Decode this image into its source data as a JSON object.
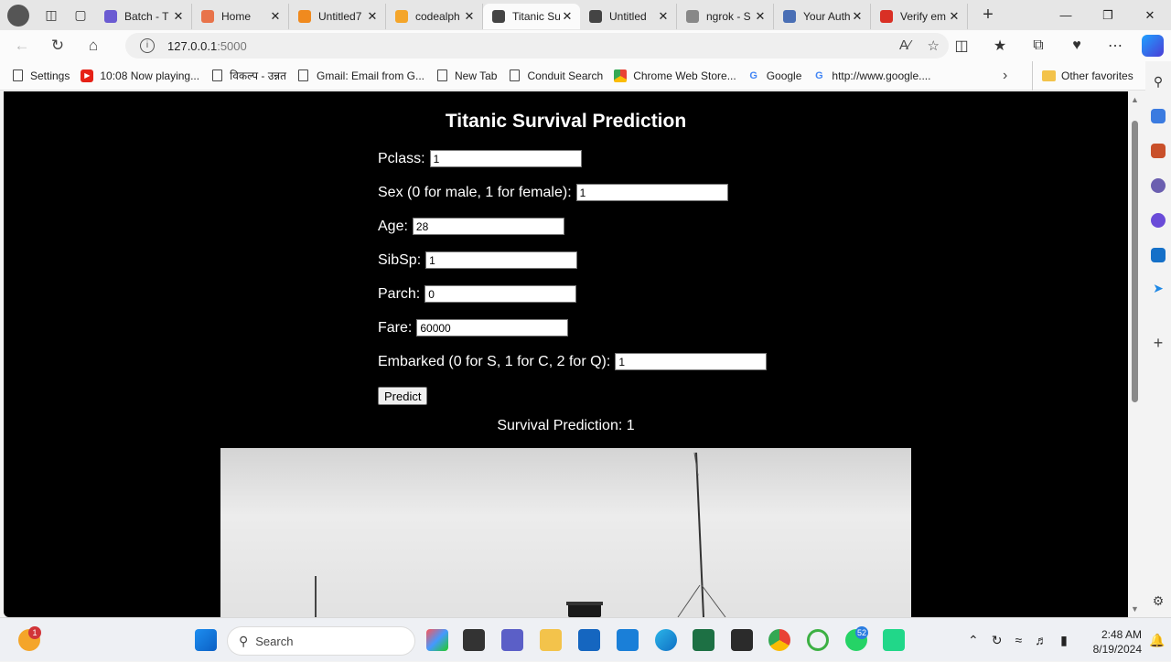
{
  "browser": {
    "tabs": [
      {
        "title": "Batch - T",
        "favicon_color": "#6b5bd2"
      },
      {
        "title": "Home",
        "favicon_color": "#e8734a"
      },
      {
        "title": "Untitled7",
        "favicon_color": "#f08a1e"
      },
      {
        "title": "codealph",
        "favicon_color": "#f4a52a"
      },
      {
        "title": "Titanic Su",
        "favicon_color": "#444444"
      },
      {
        "title": "Untitled",
        "favicon_color": "#444444"
      },
      {
        "title": "ngrok - S",
        "favicon_color": "#888888"
      },
      {
        "title": "Your Auth",
        "favicon_color": "#4a6fb5"
      },
      {
        "title": "Verify em",
        "favicon_color": "#d93025"
      }
    ],
    "active_tab_index": 4,
    "address": {
      "host": "127.0.0.1",
      "port": ":5000"
    },
    "bookmarks": [
      {
        "label": "Settings",
        "icon": "doc-icon"
      },
      {
        "label": "10:08 Now playing...",
        "icon": "youtube-icon"
      },
      {
        "label": "विकल्प - उन्नत",
        "icon": "doc-icon"
      },
      {
        "label": "Gmail: Email from G...",
        "icon": "doc-icon"
      },
      {
        "label": "New Tab",
        "icon": "doc-icon"
      },
      {
        "label": "Conduit Search",
        "icon": "doc-icon"
      },
      {
        "label": "Chrome Web Store...",
        "icon": "webstore-icon"
      },
      {
        "label": "Google",
        "icon": "google-icon"
      },
      {
        "label": "http://www.google....",
        "icon": "google-icon"
      }
    ],
    "other_favorites": "Other favorites"
  },
  "page": {
    "title": "Titanic Survival Prediction",
    "fields": [
      {
        "label": "Pclass:",
        "value": "1"
      },
      {
        "label": "Sex (0 for male, 1 for female):",
        "value": "1"
      },
      {
        "label": "Age:",
        "value": "28"
      },
      {
        "label": "SibSp:",
        "value": "1"
      },
      {
        "label": "Parch:",
        "value": "0"
      },
      {
        "label": "Fare:",
        "value": "60000"
      },
      {
        "label": "Embarked (0 for S, 1 for C, 2 for Q):",
        "value": "1"
      }
    ],
    "predict_label": "Predict",
    "result": "Survival Prediction: 1"
  },
  "taskbar": {
    "search_placeholder": "Search",
    "weather_badge": "1",
    "whatsapp_badge": "52",
    "time": "2:48 AM",
    "date": "8/19/2024"
  }
}
